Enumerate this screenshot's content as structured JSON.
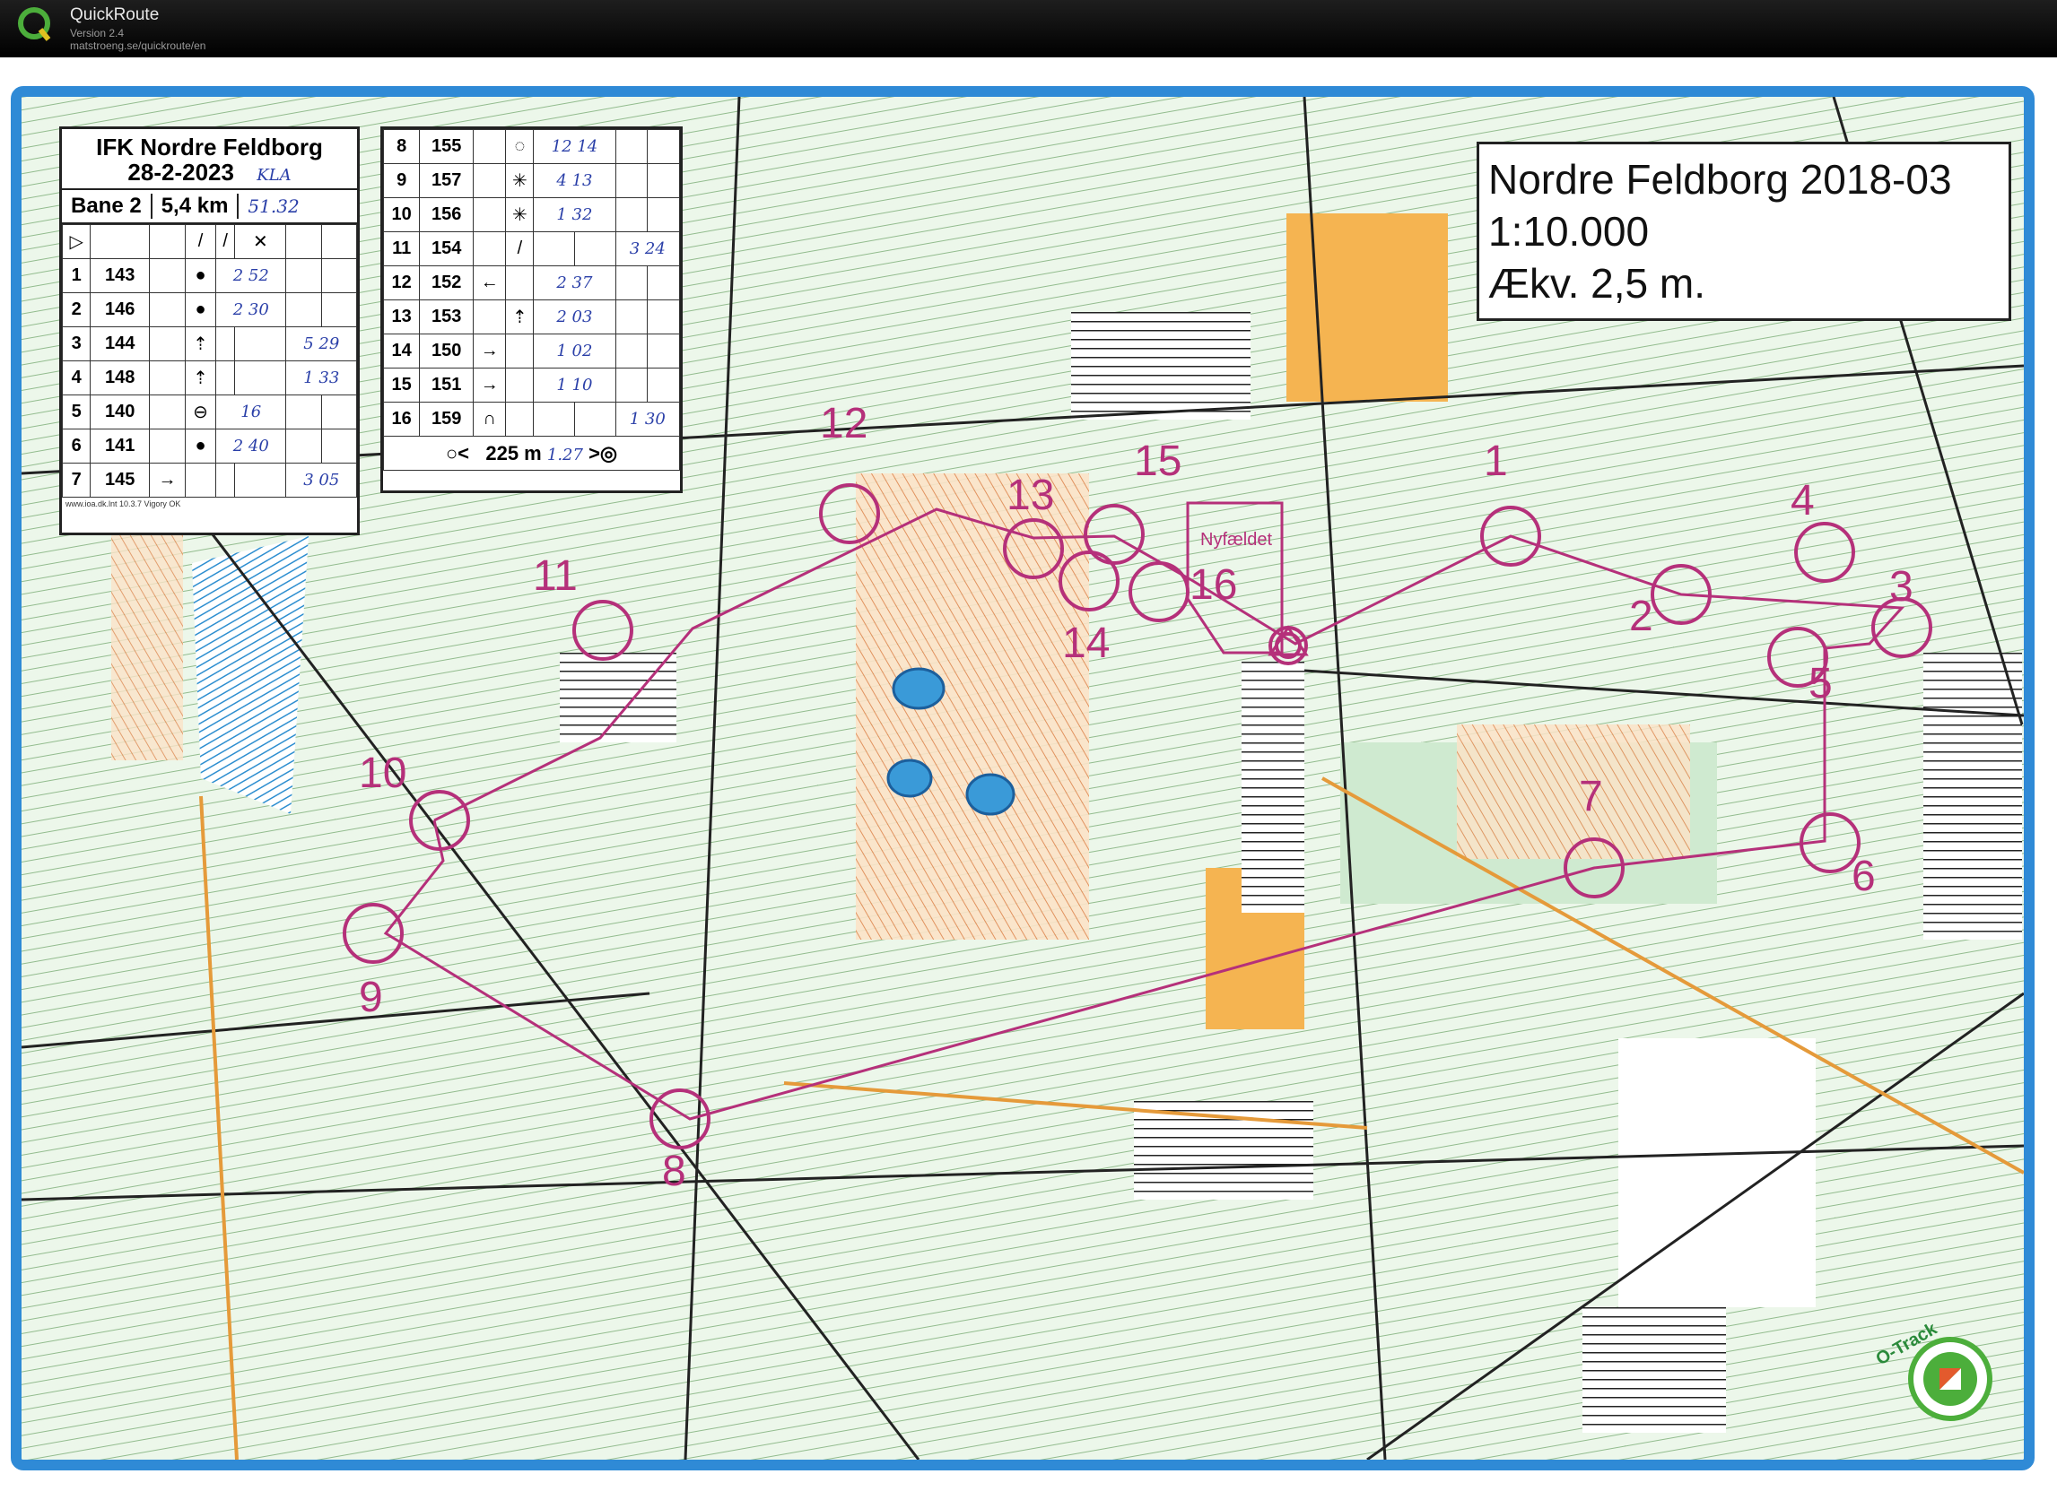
{
  "app": {
    "name": "QuickRoute",
    "version": "Version 2.4",
    "url": "matstroeng.se/quickroute/en"
  },
  "map": {
    "title_line1": "Nordre Feldborg 2018-03",
    "title_line2": "1:10.000",
    "title_line3": "Ækv. 2,5 m.",
    "place_label": "Nyfældet",
    "watermark": "O-Track",
    "frame_color": "#2f8ad6",
    "course_color": "#b5307a",
    "controls": [
      "1",
      "2",
      "3",
      "4",
      "5",
      "6",
      "7",
      "8",
      "9",
      "10",
      "11",
      "12",
      "13",
      "14",
      "15",
      "16"
    ]
  },
  "description_sheet": {
    "club": "IFK Nordre Feldborg",
    "date": "28-2-2023",
    "date_note": "KLA",
    "course": "Bane 2",
    "length": "5,4 km",
    "total_time": "51.32",
    "footer": "www.ioa.dk.lnt 10.3.7 Vigory OK",
    "rows_left": [
      {
        "n": "1",
        "code": "143",
        "sym": "●",
        "t": "2 52"
      },
      {
        "n": "2",
        "code": "146",
        "sym": "●",
        "t": "2 30"
      },
      {
        "n": "3",
        "code": "144",
        "sym": "⇡",
        "t": "5 29"
      },
      {
        "n": "4",
        "code": "148",
        "sym": "⇡",
        "t": "1 33"
      },
      {
        "n": "5",
        "code": "140",
        "sym": "⊖",
        "t": "16"
      },
      {
        "n": "6",
        "code": "141",
        "sym": "●",
        "t": "2 40"
      },
      {
        "n": "7",
        "code": "145",
        "sym": "→",
        "t": "3 05"
      }
    ],
    "rows_right": [
      {
        "n": "8",
        "code": "155",
        "sym": "◌",
        "t": "12 14"
      },
      {
        "n": "9",
        "code": "157",
        "sym": "✳",
        "t": "4 13"
      },
      {
        "n": "10",
        "code": "156",
        "sym": "✳",
        "t": "1 32"
      },
      {
        "n": "11",
        "code": "154",
        "sym": "/",
        "t": "3 24"
      },
      {
        "n": "12",
        "code": "152",
        "sym": "←",
        "t": "2 37"
      },
      {
        "n": "13",
        "code": "153",
        "sym": "⇡",
        "t": "2 03"
      },
      {
        "n": "14",
        "code": "150",
        "sym": "→",
        "t": "1 02"
      },
      {
        "n": "15",
        "code": "151",
        "sym": "→",
        "t": "1 10"
      },
      {
        "n": "16",
        "code": "159",
        "sym": "∩",
        "t": "1 30"
      }
    ],
    "finish_distance": "225 m",
    "finish_time": "1.27"
  }
}
